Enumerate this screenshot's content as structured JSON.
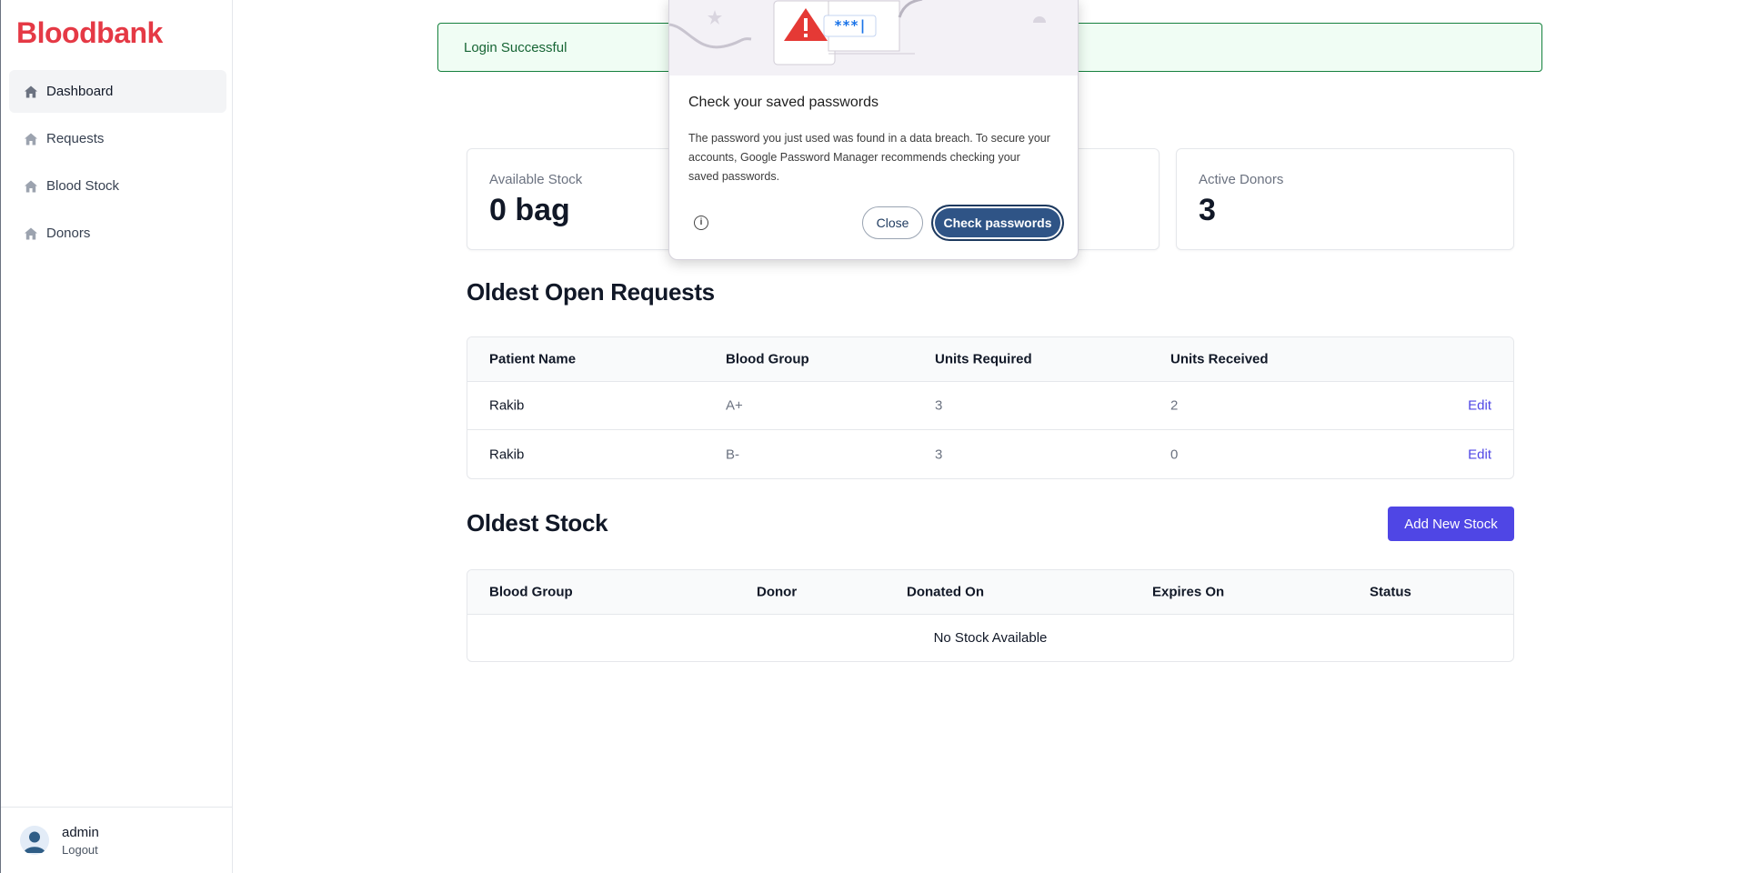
{
  "app": {
    "brand": "Bloodbank"
  },
  "sidebar": {
    "items": [
      {
        "label": "Dashboard",
        "icon": "home-icon",
        "active": true
      },
      {
        "label": "Requests",
        "icon": "home-icon",
        "active": false
      },
      {
        "label": "Blood Stock",
        "icon": "home-icon",
        "active": false
      },
      {
        "label": "Donors",
        "icon": "home-icon",
        "active": false
      }
    ],
    "user": {
      "name": "admin",
      "logout_label": "Logout",
      "icon": "user-avatar-icon"
    }
  },
  "alert": {
    "message": "Login Successful",
    "color": "#15803d"
  },
  "stats": [
    {
      "label": "Available Stock",
      "value": "0 bag"
    },
    {
      "label": "Active Donors",
      "value": "3"
    }
  ],
  "open_requests": {
    "title": "Oldest Open Requests",
    "columns": [
      "Patient Name",
      "Blood Group",
      "Units Required",
      "Units Received"
    ],
    "rows": [
      {
        "patient": "Rakib",
        "group": "A+",
        "required": "3",
        "received": "2",
        "action": "Edit"
      },
      {
        "patient": "Rakib",
        "group": "B-",
        "required": "3",
        "received": "0",
        "action": "Edit"
      }
    ]
  },
  "oldest_stock": {
    "title": "Oldest Stock",
    "add_button": "Add New Stock",
    "columns": [
      "Blood Group",
      "Donor",
      "Donated On",
      "Expires On",
      "Status"
    ],
    "empty_message": "No Stock Available"
  },
  "password_popup": {
    "title": "Check your saved passwords",
    "body": "The password you just used was found in a data breach. To secure your accounts, Google Password Manager recommends checking your saved passwords.",
    "masked": "***|",
    "close_label": "Close",
    "check_label": "Check passwords",
    "info_icon": "info-icon",
    "warning_icon": "warning-triangle-icon"
  },
  "colors": {
    "brand": "#e53945",
    "accent": "#4f46e5",
    "popup_primary": "#2f5486"
  }
}
